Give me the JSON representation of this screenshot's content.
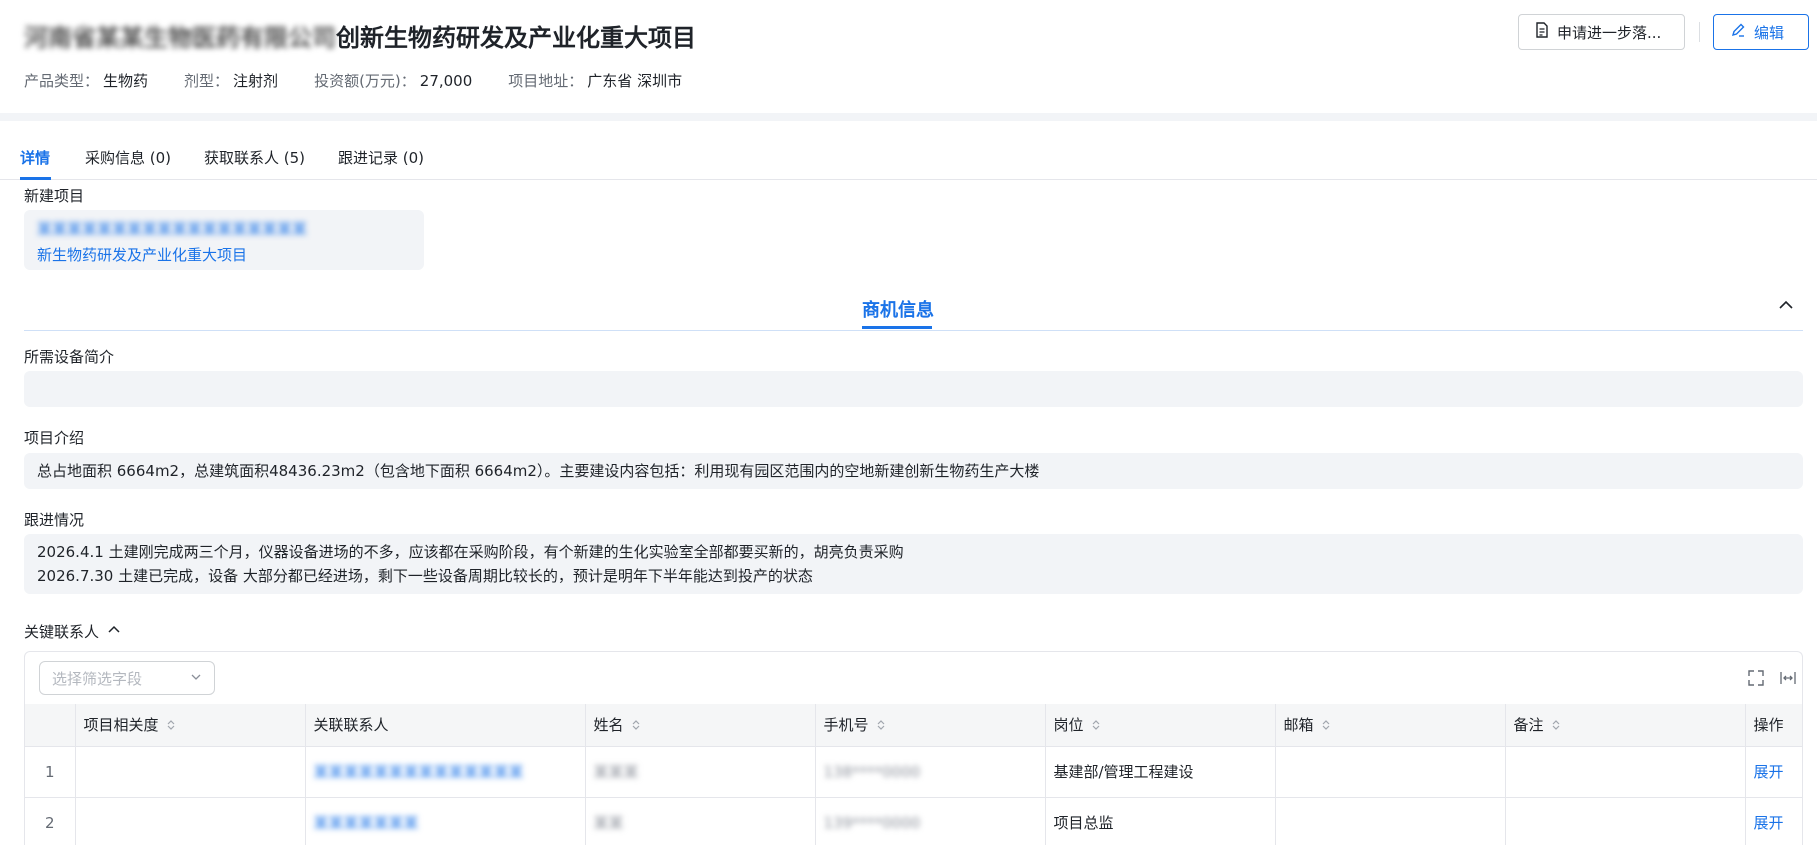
{
  "header": {
    "title_blurred": "河南省某某生物医药有限公司",
    "title_visible": "创新生物药研发及产业化重大项目",
    "meta": [
      {
        "label": "产品类型：",
        "value": "生物药"
      },
      {
        "label": "剂型：",
        "value": "注射剂"
      },
      {
        "label": "投资额(万元)：",
        "value": "27,000"
      },
      {
        "label": "项目地址：",
        "value": "广东省 深圳市"
      }
    ],
    "apply_button": "申请进一步落...",
    "edit_button": "编辑"
  },
  "tabs": [
    {
      "label": "详情"
    },
    {
      "label": "采购信息 (0)"
    },
    {
      "label": "获取联系人 (5)"
    },
    {
      "label": "跟进记录 (0)"
    }
  ],
  "new_project": {
    "label": "新建项目",
    "blurred_line": "某某某某某某某某某某某某某某某某某某",
    "link_text": "新生物药研发及产业化重大项目"
  },
  "business_section": {
    "title": "商机信息",
    "equipment_label": "所需设备简介",
    "equipment_value": "",
    "intro_label": "项目介绍",
    "intro_value": "总占地面积 6664m2，总建筑面积48436.23m2（包含地下面积 6664m2）。主要建设内容包括：利用现有园区范围内的空地新建创新生物药生产大楼",
    "followup_label": "跟进情况",
    "followup_lines": [
      "2026.4.1  土建刚完成两三个月，仪器设备进场的不多，应该都在采购阶段，有个新建的生化实验室全部都要买新的，胡亮负责采购",
      "2026.7.30  土建已完成，设备 大部分都已经进场，剩下一些设备周期比较长的，预计是明年下半年能达到投产的状态"
    ]
  },
  "key_contacts": {
    "label": "关键联系人",
    "filter_placeholder": "选择筛选字段",
    "columns": [
      "",
      "项目相关度",
      "关联联系人",
      "姓名",
      "手机号",
      "岗位",
      "邮箱",
      "备注",
      "操作"
    ],
    "rows": [
      {
        "index": "1",
        "relevance": "",
        "linked_contact": "某某某某某某某某某某某某某某",
        "name": "某某某",
        "phone": "138****0000",
        "position": "基建部/管理工程建设",
        "email": "",
        "note": "",
        "action": "展开"
      },
      {
        "index": "2",
        "relevance": "",
        "linked_contact": "某某某某某某某",
        "name": "某某",
        "phone": "139****0000",
        "position": "项目总监",
        "email": "",
        "note": "",
        "action": "展开"
      }
    ]
  },
  "colors": {
    "accent": "#1a73e8",
    "page_bg": "#f2f4f7",
    "field_bg": "#f2f4f7"
  }
}
